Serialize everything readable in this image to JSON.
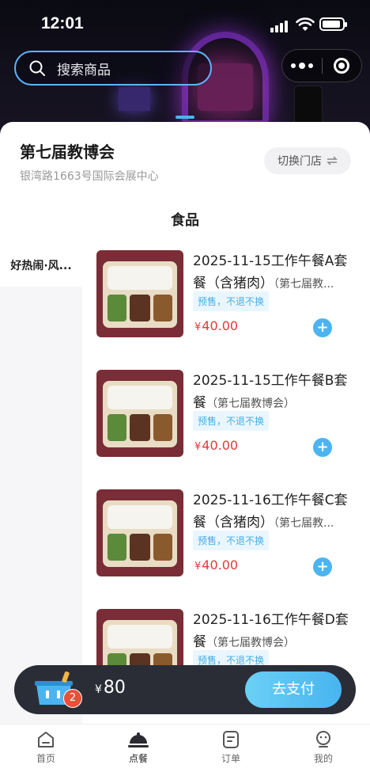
{
  "status_bar": {
    "time": "12:01"
  },
  "search": {
    "placeholder": "搜索商品"
  },
  "store": {
    "name": "第七届教博会",
    "address": "银湾路1663号国际会展中心",
    "switch_label": "切换门店",
    "switch_icon": "swap-icon"
  },
  "tabs": [
    {
      "label": "食品",
      "active": true
    }
  ],
  "sidebar": {
    "items": [
      {
        "label": "好热闹·风...",
        "active": true
      }
    ]
  },
  "products": [
    {
      "title": "2025-11-15工作午餐A套餐（含猪肉）",
      "subtitle": "（第七届教...",
      "tag": "预售，不退不换",
      "currency": "¥",
      "price": "40.00"
    },
    {
      "title": "2025-11-15工作午餐B套餐",
      "subtitle": "（第七届教博会）",
      "tag": "预售，不退不换",
      "currency": "¥",
      "price": "40.00"
    },
    {
      "title": "2025-11-16工作午餐C套餐（含猪肉）",
      "subtitle": "（第七届教...",
      "tag": "预售，不退不换",
      "currency": "¥",
      "price": "40.00"
    },
    {
      "title": "2025-11-16工作午餐D套餐",
      "subtitle": "（第七届教博会）",
      "tag": "预售，不退不换",
      "currency": "¥",
      "price": ""
    }
  ],
  "cart": {
    "badge_count": "2",
    "currency": "¥",
    "total": "80",
    "pay_label": "去支付"
  },
  "tabbar": {
    "items": [
      {
        "label": "首页",
        "icon": "home-icon",
        "active": false
      },
      {
        "label": "点餐",
        "icon": "order-food-icon",
        "active": true
      },
      {
        "label": "订单",
        "icon": "orders-icon",
        "active": false
      },
      {
        "label": "我的",
        "icon": "profile-icon",
        "active": false
      }
    ]
  },
  "colors": {
    "accent": "#4cb4f0",
    "price": "#e23b3b",
    "cart_bar": "#2b2d36",
    "badge": "#e8503a"
  }
}
